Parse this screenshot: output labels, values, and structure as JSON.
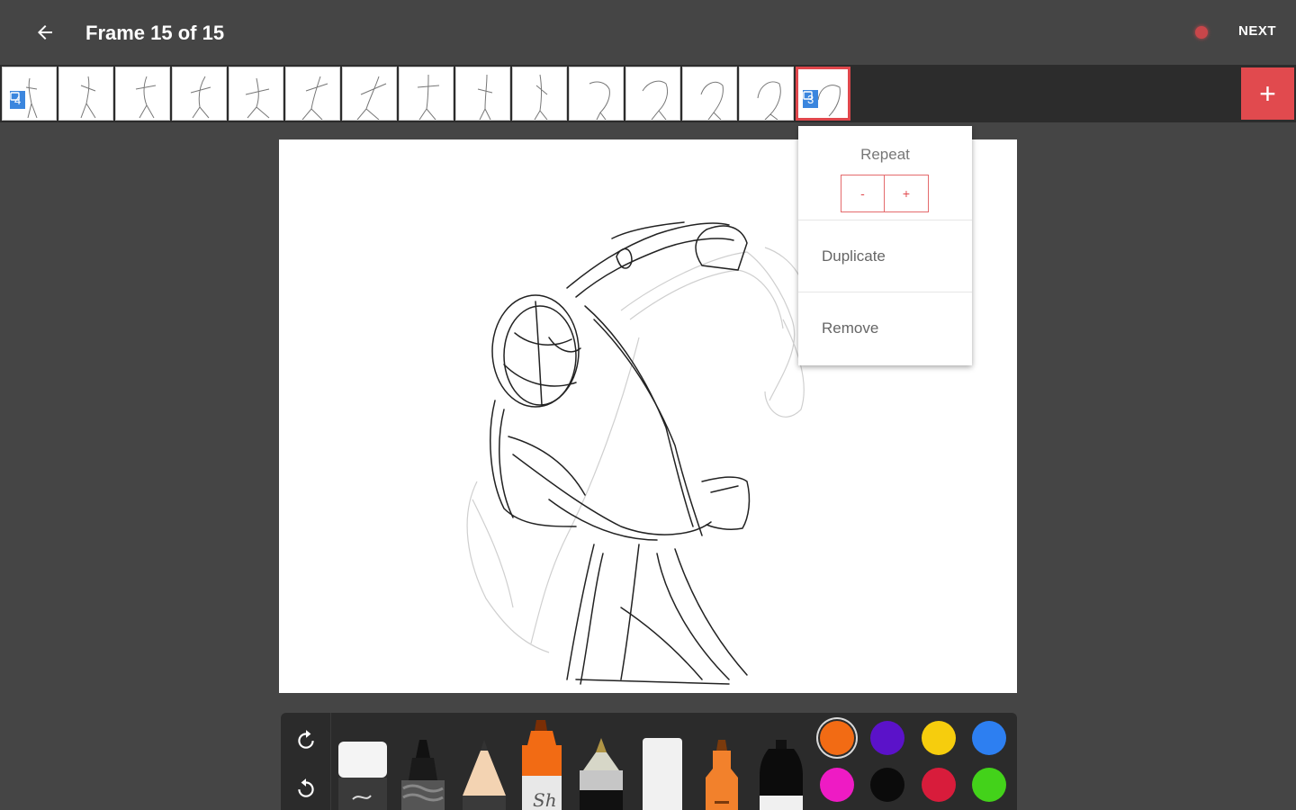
{
  "header": {
    "title": "Frame 15 of 15",
    "next_label": "NEXT"
  },
  "filmstrip": {
    "frames": [
      {
        "badge": "4"
      },
      {},
      {},
      {},
      {},
      {},
      {},
      {},
      {},
      {},
      {},
      {},
      {},
      {},
      {
        "badge": "3",
        "selected": true
      }
    ],
    "add_label": "+"
  },
  "popup": {
    "repeat_label": "Repeat",
    "decrement_label": "-",
    "increment_label": "+",
    "duplicate_label": "Duplicate",
    "remove_label": "Remove"
  },
  "toolbar": {
    "tools": [
      "eraser",
      "marker",
      "pencil",
      "highlighter",
      "pen",
      "chalk",
      "paint",
      "ink"
    ],
    "colors": [
      "#f26b14",
      "#5b12c9",
      "#f6cd0d",
      "#2d7ff1",
      "#ee1bc4",
      "#0b0b0b",
      "#d81c3b",
      "#43d21a"
    ],
    "active_color": "#f26b14"
  },
  "theme": {
    "accent": "#e14a4e",
    "badge": "#3b86de",
    "background": "#454545"
  }
}
